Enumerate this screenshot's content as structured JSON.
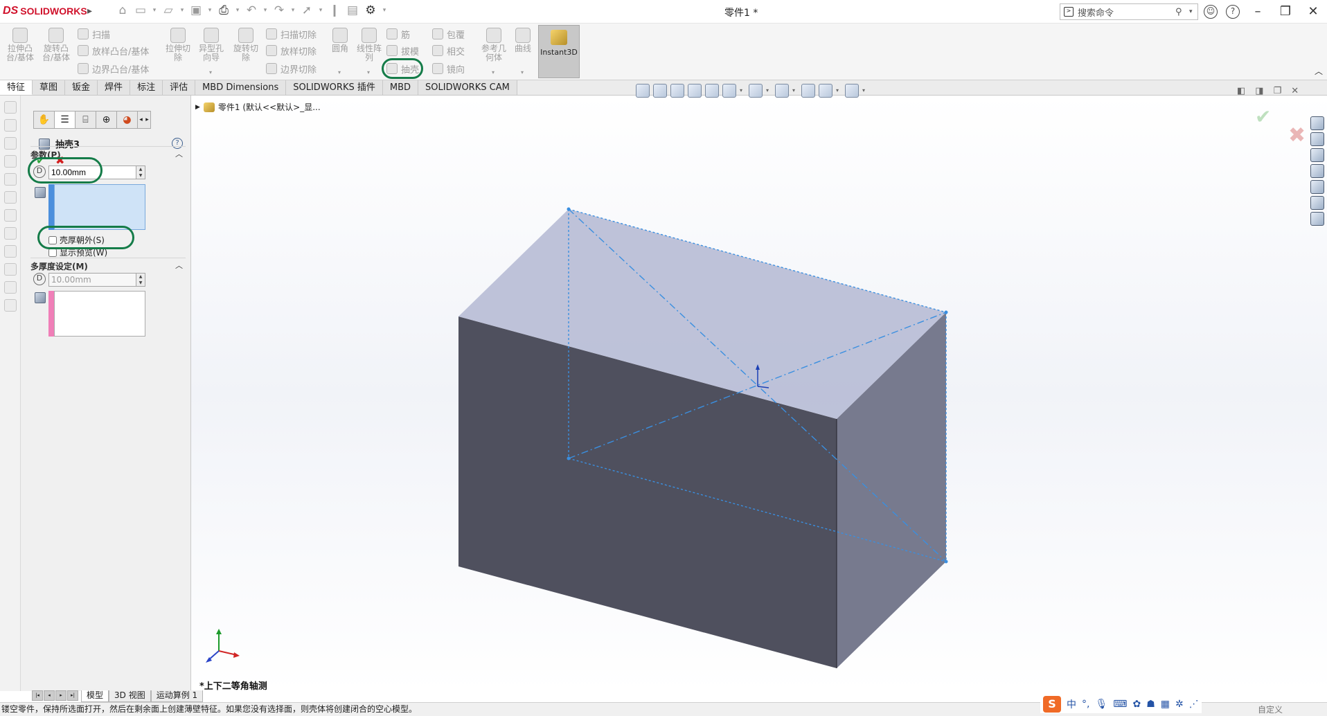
{
  "app": {
    "logo_mark": "DS",
    "logo_word": "SOLIDWORKS",
    "doc_title": "零件1 *"
  },
  "search": {
    "placeholder": "搜索命令"
  },
  "quick_access": {
    "icons": [
      "home-icon",
      "new-file-icon",
      "open-file-icon",
      "save-icon",
      "print-icon",
      "undo-icon",
      "redo-icon",
      "select-icon",
      "rebuild-icon",
      "file-properties-icon",
      "options-gear-icon"
    ]
  },
  "ribbon": {
    "big_buttons": [
      {
        "key": "extrude_boss",
        "label": "拉伸凸\n台/基体"
      },
      {
        "key": "revolve_boss",
        "label": "旋转凸\n台/基体"
      },
      {
        "key": "extrude_cut",
        "label": "拉伸切\n除"
      },
      {
        "key": "hole_wizard",
        "label": "异型孔\n向导"
      },
      {
        "key": "revolve_cut",
        "label": "旋转切\n除"
      },
      {
        "key": "fillet",
        "label": "圆角"
      },
      {
        "key": "linear_pattern",
        "label": "线性阵\n列"
      },
      {
        "key": "reference_geometry",
        "label": "参考几\n何体"
      },
      {
        "key": "curves",
        "label": "曲线"
      }
    ],
    "small_buttons": [
      {
        "key": "sweep",
        "label": "扫描"
      },
      {
        "key": "loft_boss",
        "label": "放样凸台/基体"
      },
      {
        "key": "boundary_boss",
        "label": "边界凸台/基体"
      },
      {
        "key": "swept_cut",
        "label": "扫描切除"
      },
      {
        "key": "loft_cut",
        "label": "放样切除"
      },
      {
        "key": "boundary_cut",
        "label": "边界切除"
      },
      {
        "key": "rib",
        "label": "筋"
      },
      {
        "key": "draft",
        "label": "拔模"
      },
      {
        "key": "shell",
        "label": "抽壳"
      },
      {
        "key": "wrap",
        "label": "包覆"
      },
      {
        "key": "intersect",
        "label": "相交"
      },
      {
        "key": "mirror",
        "label": "镜向"
      }
    ],
    "instant3d": "Instant3D"
  },
  "tabs": [
    {
      "label": "特征",
      "active": true
    },
    {
      "label": "草图"
    },
    {
      "label": "钣金"
    },
    {
      "label": "焊件"
    },
    {
      "label": "标注"
    },
    {
      "label": "评估"
    },
    {
      "label": "MBD Dimensions"
    },
    {
      "label": "SOLIDWORKS 插件"
    },
    {
      "label": "MBD"
    },
    {
      "label": "SOLIDWORKS CAM"
    }
  ],
  "property_manager": {
    "title": "抽壳3",
    "help": "?",
    "ok": "✔",
    "cancel": "✖",
    "parameters": {
      "header": "参数(P)",
      "thickness_value": "10.00mm",
      "shell_outward_label": "壳厚朝外(S)",
      "shell_outward_checked": false,
      "show_preview_label": "显示预览(W)",
      "show_preview_checked": false
    },
    "multi_thickness": {
      "header": "多厚度设定(M)",
      "thickness_value": "10.00mm"
    }
  },
  "tree": {
    "part_label": "零件1  (默认<<默认>_显..."
  },
  "view": {
    "name": "*上下二等角轴测"
  },
  "bottom_tabs": [
    {
      "label": "模型",
      "active": true
    },
    {
      "label": "3D 视图"
    },
    {
      "label": "运动算例 1"
    }
  ],
  "status": {
    "message": "镂空零件，保持所选面打开，然后在剩余面上创建薄壁特征。如果您没有选择面，则壳体将创建闭合的空心模型。",
    "right_text": "自定义",
    "ime_logo": "S",
    "ime_lang": "中"
  },
  "colors": {
    "annotation_green": "#157c49",
    "box_top": "#b8bdd6",
    "box_front": "#4f505e",
    "box_side": "#777a8e",
    "preview_blue": "#3a8fe0",
    "brand_red": "#d0112b"
  }
}
